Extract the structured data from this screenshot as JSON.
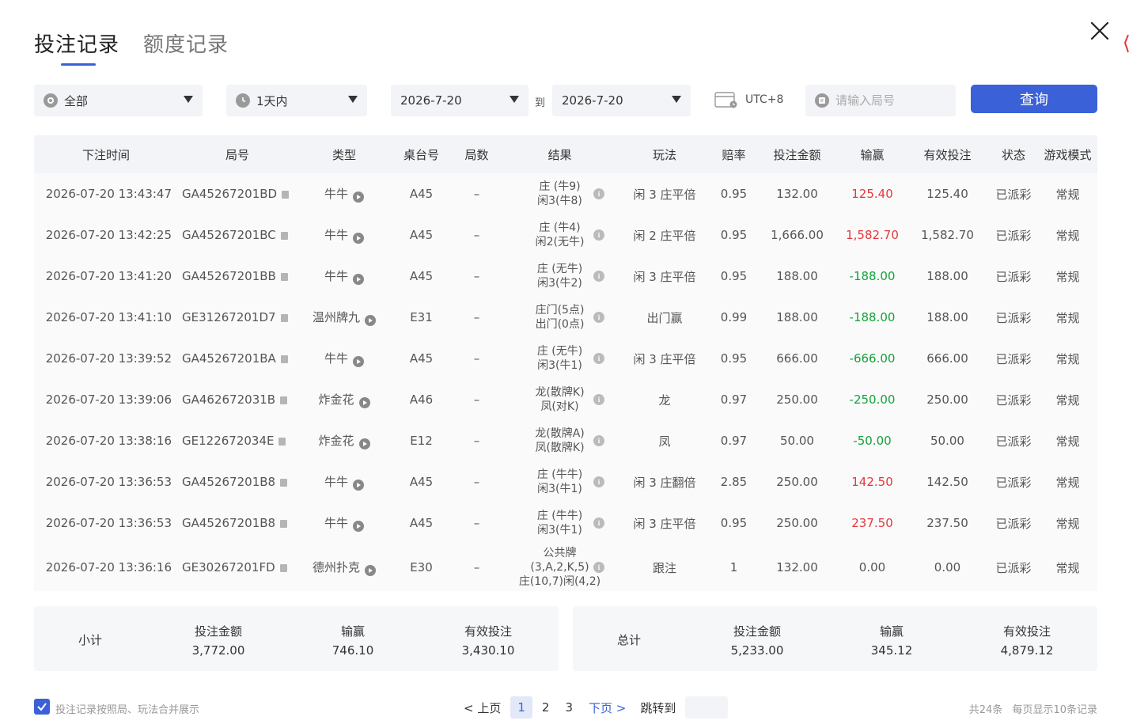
{
  "tabs": [
    {
      "label": "投注记录",
      "active": true
    },
    {
      "label": "额度记录",
      "active": false
    }
  ],
  "filters": {
    "category": "全部",
    "time_range": "1天内",
    "date_from": "2026-7-20",
    "to_label": "到",
    "date_to": "2026-7-20",
    "timezone": "UTC+8",
    "round_placeholder": "请输入局号",
    "query_label": "查询"
  },
  "table": {
    "headers": [
      "下注时间",
      "局号",
      "类型",
      "桌台号",
      "局数",
      "结果",
      "玩法",
      "赔率",
      "投注金额",
      "输赢",
      "有效投注",
      "状态",
      "游戏模式"
    ],
    "rows": [
      {
        "time": "2026-07-20 13:43:47",
        "round": "GA45267201BD",
        "type": "牛牛",
        "table": "A45",
        "count": "–",
        "result": [
          "庄 (牛9)",
          "闲3(牛8)"
        ],
        "play": "闲 3 庄平倍",
        "odds": "0.95",
        "amount": "132.00",
        "win": "125.40",
        "win_sign": "pos",
        "valid": "125.40",
        "status": "已派彩",
        "mode": "常规"
      },
      {
        "time": "2026-07-20 13:42:25",
        "round": "GA45267201BC",
        "type": "牛牛",
        "table": "A45",
        "count": "–",
        "result": [
          "庄 (牛4)",
          "闲2(无牛)"
        ],
        "play": "闲 2 庄平倍",
        "odds": "0.95",
        "amount": "1,666.00",
        "win": "1,582.70",
        "win_sign": "pos",
        "valid": "1,582.70",
        "status": "已派彩",
        "mode": "常规"
      },
      {
        "time": "2026-07-20 13:41:20",
        "round": "GA45267201BB",
        "type": "牛牛",
        "table": "A45",
        "count": "–",
        "result": [
          "庄 (无牛)",
          "闲3(牛2)"
        ],
        "play": "闲 3 庄平倍",
        "odds": "0.95",
        "amount": "188.00",
        "win": "-188.00",
        "win_sign": "neg",
        "valid": "188.00",
        "status": "已派彩",
        "mode": "常规"
      },
      {
        "time": "2026-07-20 13:41:10",
        "round": "GE31267201D7",
        "type": "温州牌九",
        "table": "E31",
        "count": "–",
        "result": [
          "庄门(5点)",
          "出门(0点)"
        ],
        "play": "出门赢",
        "odds": "0.99",
        "amount": "188.00",
        "win": "-188.00",
        "win_sign": "neg",
        "valid": "188.00",
        "status": "已派彩",
        "mode": "常规"
      },
      {
        "time": "2026-07-20 13:39:52",
        "round": "GA45267201BA",
        "type": "牛牛",
        "table": "A45",
        "count": "–",
        "result": [
          "庄 (无牛)",
          "闲3(牛1)"
        ],
        "play": "闲 3 庄平倍",
        "odds": "0.95",
        "amount": "666.00",
        "win": "-666.00",
        "win_sign": "neg",
        "valid": "666.00",
        "status": "已派彩",
        "mode": "常规"
      },
      {
        "time": "2026-07-20 13:39:06",
        "round": "GA462672031B",
        "type": "炸金花",
        "table": "A46",
        "count": "–",
        "result": [
          "龙(散牌K)",
          "凤(对K)"
        ],
        "play": "龙",
        "odds": "0.97",
        "amount": "250.00",
        "win": "-250.00",
        "win_sign": "neg",
        "valid": "250.00",
        "status": "已派彩",
        "mode": "常规"
      },
      {
        "time": "2026-07-20 13:38:16",
        "round": "GE122672034E",
        "type": "炸金花",
        "table": "E12",
        "count": "–",
        "result": [
          "龙(散牌A)",
          "凤(散牌K)"
        ],
        "play": "凤",
        "odds": "0.97",
        "amount": "50.00",
        "win": "-50.00",
        "win_sign": "neg",
        "valid": "50.00",
        "status": "已派彩",
        "mode": "常规"
      },
      {
        "time": "2026-07-20 13:36:53",
        "round": "GA45267201B8",
        "type": "牛牛",
        "table": "A45",
        "count": "–",
        "result": [
          "庄 (牛牛)",
          "闲3(牛1)"
        ],
        "play": "闲 3 庄翻倍",
        "odds": "2.85",
        "amount": "250.00",
        "win": "142.50",
        "win_sign": "pos",
        "valid": "142.50",
        "status": "已派彩",
        "mode": "常规"
      },
      {
        "time": "2026-07-20 13:36:53",
        "round": "GA45267201B8",
        "type": "牛牛",
        "table": "A45",
        "count": "–",
        "result": [
          "庄 (牛牛)",
          "闲3(牛1)"
        ],
        "play": "闲 3 庄平倍",
        "odds": "0.95",
        "amount": "250.00",
        "win": "237.50",
        "win_sign": "pos",
        "valid": "237.50",
        "status": "已派彩",
        "mode": "常规"
      },
      {
        "time": "2026-07-20 13:36:16",
        "round": "GE30267201FD",
        "type": "德州扑克",
        "table": "E30",
        "count": "–",
        "result": [
          "公共牌",
          "(3,A,2,K,5)",
          "庄(10,7)闲(4,2)"
        ],
        "play": "跟注",
        "odds": "1",
        "amount": "132.00",
        "win": "0.00",
        "win_sign": "zero",
        "valid": "0.00",
        "status": "已派彩",
        "mode": "常规"
      }
    ]
  },
  "subtotal": {
    "label": "小计",
    "amount_label": "投注金额",
    "amount": "3,772.00",
    "win_label": "输赢",
    "win": "746.10",
    "valid_label": "有效投注",
    "valid": "3,430.10"
  },
  "total": {
    "label": "总计",
    "amount_label": "投注金额",
    "amount": "5,233.00",
    "win_label": "输赢",
    "win": "345.12",
    "valid_label": "有效投注",
    "valid": "4,879.12"
  },
  "footer": {
    "merge_label": "投注记录按照局、玩法合并展示",
    "merge_checked": true,
    "prev_label": "< 上页",
    "pages": [
      "1",
      "2",
      "3"
    ],
    "current_page": "1",
    "next_label": "下页 >",
    "jump_label": "跳转到",
    "total_text": "共24条",
    "per_page_text": "每页显示10条记录"
  },
  "colors": {
    "accent": "#3b61d8",
    "positive": "#e6373a",
    "negative": "#13a13a"
  },
  "icons": {
    "close": "close-icon",
    "category": "category-icon",
    "clock": "clock-icon",
    "calendar": "calendar-icon",
    "search": "search-icon",
    "info": "info-icon",
    "copy": "copy-icon",
    "play": "play-icon",
    "check": "check-icon"
  }
}
